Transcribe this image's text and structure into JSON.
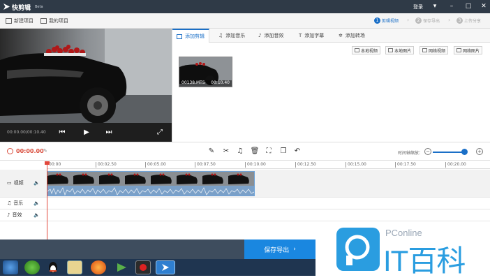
{
  "titlebar": {
    "app_name": "快剪辑",
    "beta": "Beta",
    "login": "登录"
  },
  "toolbar": {
    "new_project": "新建项目",
    "my_projects": "我的项目",
    "steps": [
      {
        "num": "1",
        "label": "剪辑视频"
      },
      {
        "num": "2",
        "label": "保存导出"
      },
      {
        "num": "3",
        "label": "上传分享"
      }
    ]
  },
  "preview": {
    "time": "00:00.00/00:10.40"
  },
  "media": {
    "tabs": [
      "添加剪辑",
      "添加音乐",
      "添加音效",
      "添加字幕",
      "添加转场"
    ],
    "sources": [
      "本地视频",
      "本地图片",
      "网络视频",
      "网络图片"
    ],
    "clip": {
      "name": "00138.MTS",
      "duration": "00:10.40"
    }
  },
  "edit": {
    "current_time": "00:00.00",
    "zoom_label": "时间轴缩放："
  },
  "timeline": {
    "ticks": [
      "00:00",
      "00:02.50",
      "00:05.00",
      "00:07.50",
      "00:10.00",
      "00:12.50",
      "00:15.00",
      "00:17.50",
      "00:20.00"
    ],
    "tracks": [
      "视频",
      "音乐",
      "音效"
    ]
  },
  "export": {
    "label": "保存导出"
  },
  "watermark": {
    "brand": "PConline",
    "big": "IT百科"
  },
  "colors": {
    "accent": "#1a6fc7",
    "export": "#1a87e0",
    "playhead": "#e2483c"
  }
}
